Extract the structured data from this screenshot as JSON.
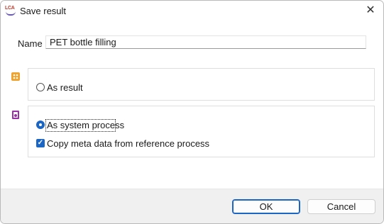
{
  "window": {
    "title": "Save result",
    "app_icon": "LCA"
  },
  "form": {
    "name_label": "Name",
    "name_value": "PET bottle filling"
  },
  "options": {
    "as_result": {
      "label": "As result",
      "selected": false,
      "icon": "result-icon",
      "icon_color": "#f0a22e"
    },
    "as_system_process": {
      "label": "As system process",
      "selected": true,
      "icon": "system-process-icon",
      "icon_color": "#9b2fa8"
    },
    "copy_meta": {
      "label": "Copy meta data from reference process",
      "checked": true
    }
  },
  "buttons": {
    "ok": "OK",
    "cancel": "Cancel"
  },
  "colors": {
    "accent": "#1b65c4"
  }
}
